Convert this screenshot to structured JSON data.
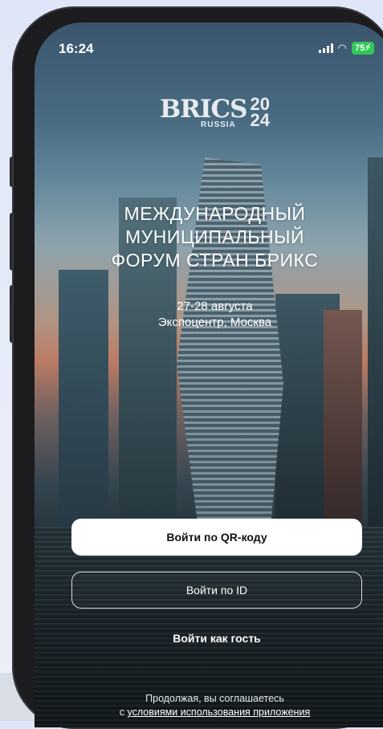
{
  "status_bar": {
    "time": "16:24",
    "battery": "75",
    "icons": [
      "cellular-signal-icon",
      "wifi-icon",
      "battery-charging-icon"
    ]
  },
  "logo": {
    "brand": "BRICS",
    "year_top": "20",
    "year_bottom": "24",
    "country": "RUSSIA"
  },
  "event": {
    "title_lines": [
      "МЕЖДУНАРОДНЫЙ",
      "МУНИЦИПАЛЬНЫЙ",
      "ФОРУМ СТРАН БРИКС"
    ],
    "dates": "27-28 августа",
    "venue": "Экспоцентр, Москва"
  },
  "actions": {
    "qr_login": "Войти по QR-коду",
    "id_login": "Войти по ID",
    "guest_login": "Войти как гость"
  },
  "terms": {
    "prefix": "Продолжая, вы соглашаетесь",
    "line2_prefix": "с ",
    "link": "условиями использования приложения"
  },
  "colors": {
    "battery_green": "#34c759",
    "primary_button_bg": "#ffffff",
    "text_light": "#ffffff"
  }
}
